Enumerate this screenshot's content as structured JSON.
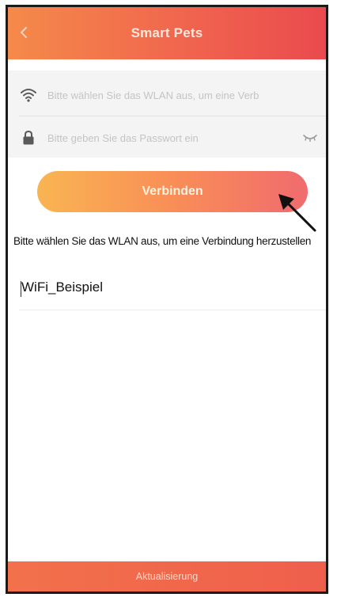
{
  "header": {
    "title": "Smart Pets",
    "back_icon": "chevron-left-icon"
  },
  "form": {
    "wifi_placeholder": "Bitte wählen Sie das WLAN aus, um eine Verb",
    "wifi_icon": "wifi-icon",
    "password_placeholder": "Bitte geben Sie das Passwort ein",
    "password_icon": "lock-icon",
    "password_toggle_icon": "eye-hidden-icon"
  },
  "connect_button": {
    "label": "Verbinden"
  },
  "info": {
    "text": "Bitte wählen Sie das WLAN aus, um eine Verbindung herzustellen"
  },
  "wifi_list": [
    {
      "ssid": "WiFi_Beispiel"
    }
  ],
  "footer": {
    "label": "Aktualisierung"
  },
  "colors": {
    "header_start": "#f58a4a",
    "header_end": "#ea4a4e",
    "button_start": "#f9b552",
    "button_end": "#f06b6e",
    "footer": "#ef5f4c"
  }
}
